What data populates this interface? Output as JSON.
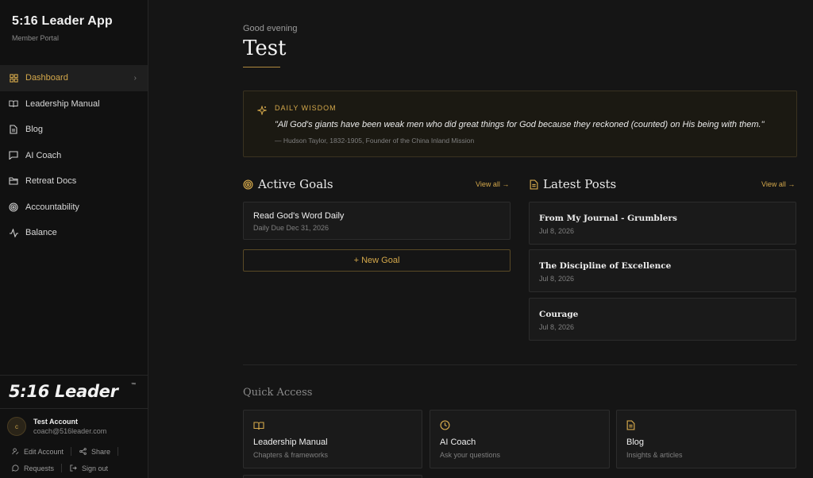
{
  "sidebar": {
    "app_title": "5:16 Leader App",
    "app_subtitle": "Member Portal",
    "items": [
      {
        "label": "Dashboard",
        "icon": "grid-icon",
        "active": true
      },
      {
        "label": "Leadership Manual",
        "icon": "book-open-icon"
      },
      {
        "label": "Blog",
        "icon": "document-icon"
      },
      {
        "label": "AI Coach",
        "icon": "chat-bubble-icon"
      },
      {
        "label": "Retreat Docs",
        "icon": "folder-icon"
      },
      {
        "label": "Accountability",
        "icon": "target-icon"
      },
      {
        "label": "Balance",
        "icon": "activity-icon"
      }
    ],
    "logo_text": "5:16 Leader",
    "logo_tm": "™",
    "account": {
      "initial": "c",
      "name": "Test Account",
      "email": "coach@516leader.com",
      "edit": "Edit Account",
      "share": "Share",
      "requests": "Requests",
      "signout": "Sign out"
    }
  },
  "main": {
    "greeting": "Good evening",
    "user_name": "Test",
    "wisdom": {
      "label": "DAILY WISDOM",
      "quote": "\"All God's giants have been weak men who did great things for God because they reckoned (counted) on His being with them.\"",
      "source": "— Hudson Taylor, 1832-1905, Founder of the China Inland Mission"
    },
    "goals": {
      "title": "Active Goals",
      "view_all": "View all →",
      "items": [
        {
          "title": "Read God's Word Daily",
          "meta": "Daily   Due Dec 31, 2026"
        }
      ],
      "new_goal": "+ New Goal"
    },
    "posts": {
      "title": "Latest Posts",
      "view_all": "View all →",
      "items": [
        {
          "title": "From My Journal - Grumblers",
          "date": "Jul 8, 2026"
        },
        {
          "title": "The Discipline of Excellence",
          "date": "Jul 8, 2026"
        },
        {
          "title": "Courage",
          "date": "Jul 8, 2026"
        }
      ]
    },
    "quick_access": {
      "title": "Quick Access",
      "items": [
        {
          "title": "Leadership Manual",
          "sub": "Chapters & frameworks",
          "icon": "book-open-icon"
        },
        {
          "title": "AI Coach",
          "sub": "Ask your questions",
          "icon": "clock-icon"
        },
        {
          "title": "Blog",
          "sub": "Insights & articles",
          "icon": "document-icon"
        }
      ]
    }
  },
  "colors": {
    "accent": "#d4a84b",
    "background": "#151515",
    "sidebar": "#111111",
    "card": "#1a1a1a"
  }
}
